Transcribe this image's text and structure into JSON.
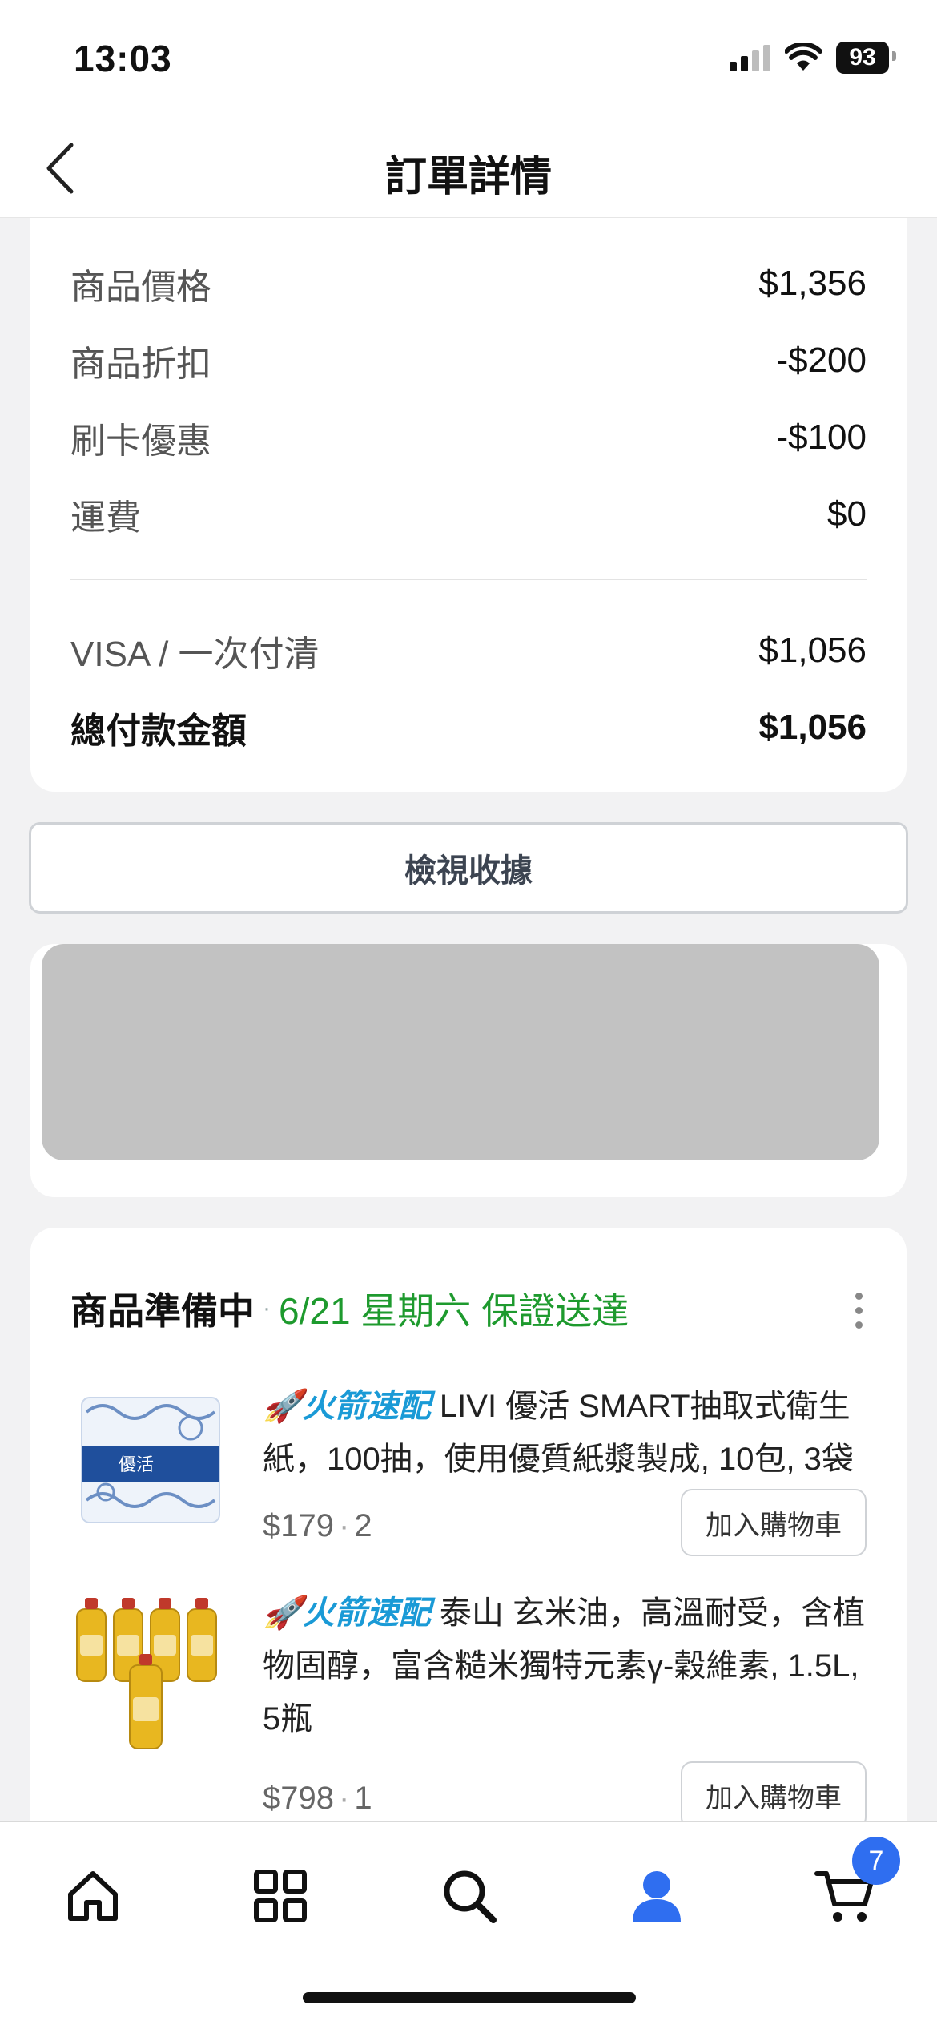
{
  "status_bar": {
    "time": "13:03",
    "battery": "93"
  },
  "header": {
    "title": "訂單詳情"
  },
  "summary": {
    "rows": [
      {
        "label": "商品價格",
        "value": "$1,356"
      },
      {
        "label": "商品折扣",
        "value": "-$200"
      },
      {
        "label": "刷卡優惠",
        "value": "-$100"
      },
      {
        "label": "運費",
        "value": "$0"
      }
    ],
    "payment": {
      "label": "VISA / 一次付清",
      "value": "$1,056"
    },
    "total": {
      "label": "總付款金額",
      "value": "$1,056"
    }
  },
  "receipt_button": "檢視收據",
  "order": {
    "status": "商品準備中",
    "separator": "·",
    "delivery": "6/21 星期六 保證送達",
    "items": [
      {
        "tag": "🚀火箭速配",
        "name": " LIVI 優活 SMART抽取式衛生紙，100抽，使用優質紙漿製成, 10包, 3袋",
        "price": "$179",
        "qty": "2",
        "button": "加入購物車"
      },
      {
        "tag": "🚀火箭速配",
        "name": " 泰山 玄米油，高溫耐受，含植物固醇，富含糙米獨特元素γ-穀維素, 1.5L, 5瓶",
        "price": "$798",
        "qty": "1",
        "button": "加入購物車"
      }
    ]
  },
  "tab_bar": {
    "tabs": [
      "home-icon",
      "categories-icon",
      "search-icon",
      "account-icon",
      "cart-icon"
    ],
    "active_color": "#2f6ef0",
    "cart_badge": "7"
  }
}
